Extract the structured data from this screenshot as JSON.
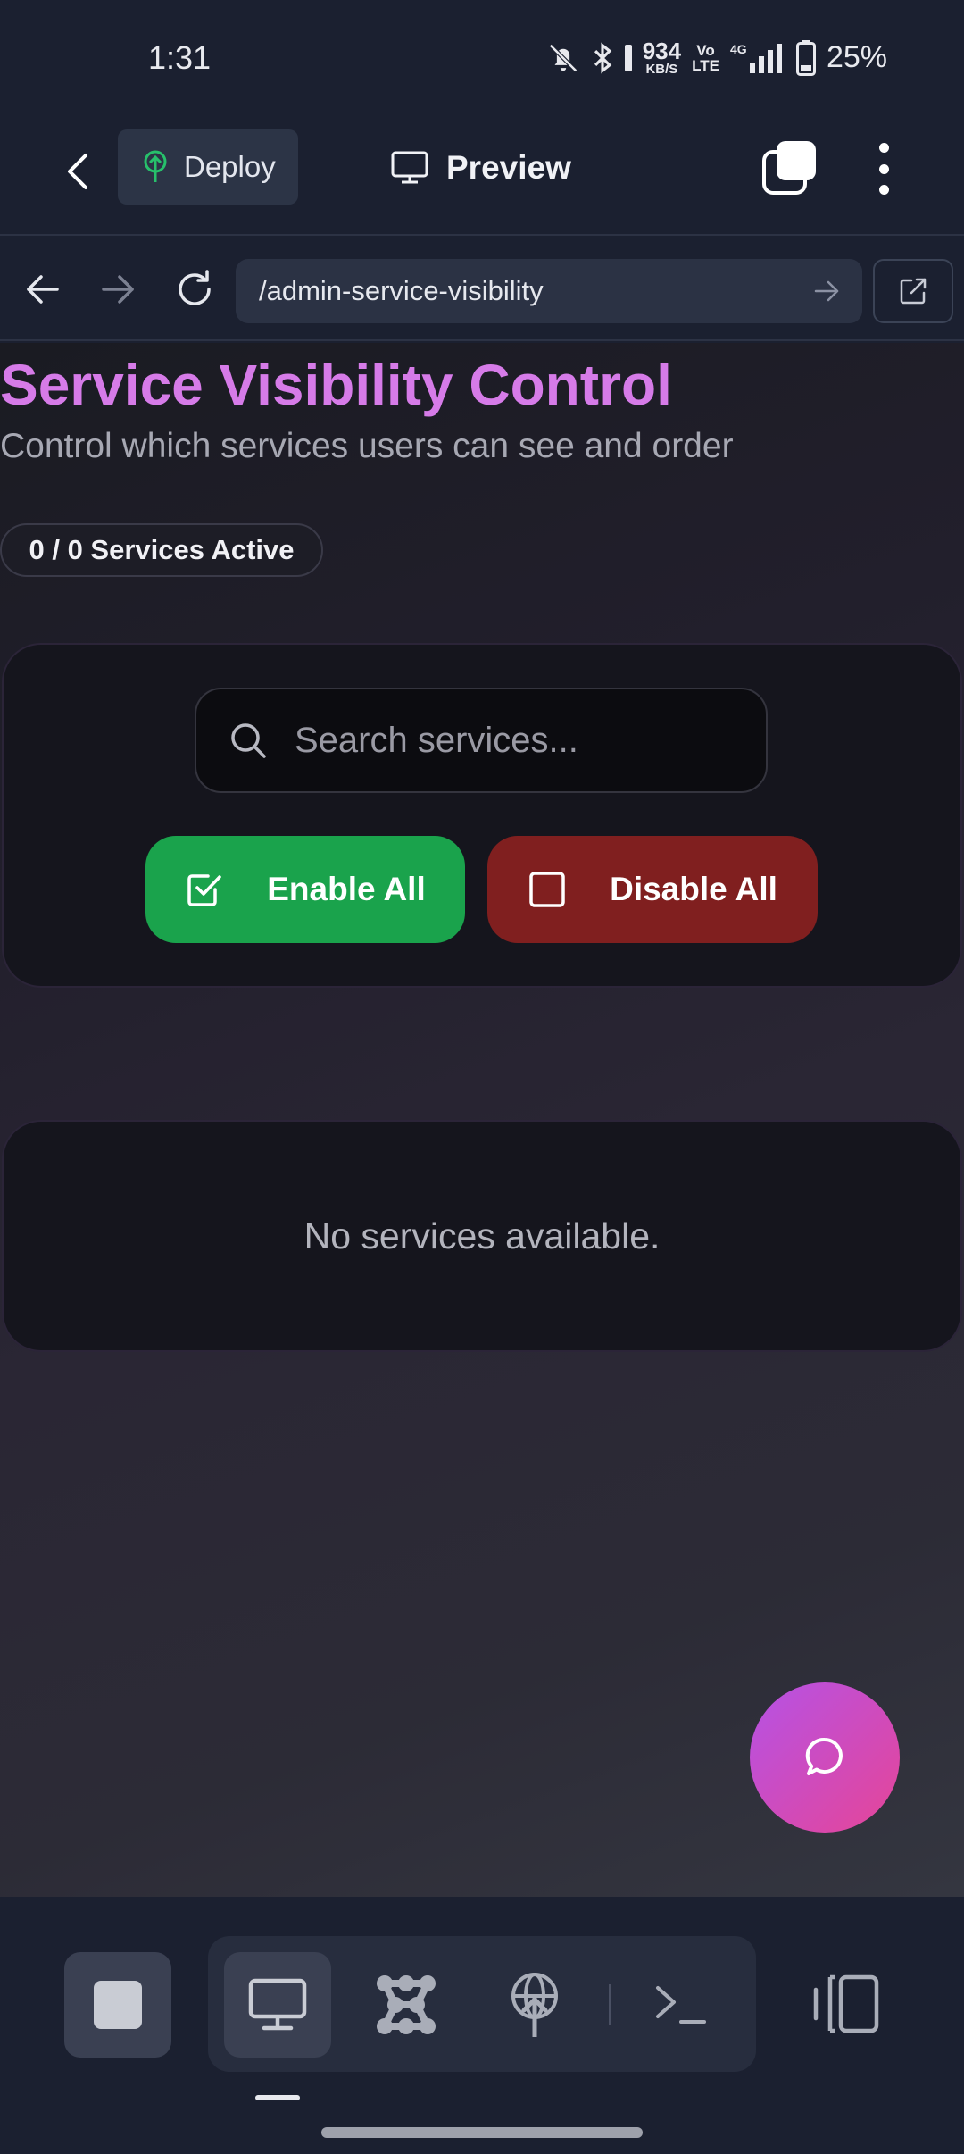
{
  "status_bar": {
    "time": "1:31",
    "net_speed_value": "934",
    "net_speed_unit": "KB/S",
    "volte_top": "Vo",
    "volte_bottom": "LTE",
    "network": "4G",
    "battery": "25%"
  },
  "header": {
    "deploy_label": "Deploy",
    "preview_label": "Preview"
  },
  "browser": {
    "url": "/admin-service-visibility"
  },
  "page": {
    "title": "Service Visibility Control",
    "subtitle": "Control which services users can see and order",
    "active_badge": "0 / 0 Services Active",
    "search_placeholder": "Search services...",
    "enable_all_label": "Enable All",
    "disable_all_label": "Disable All",
    "empty_message": "No services available."
  },
  "colors": {
    "title": "#d67be8",
    "enable_button": "#1aa34c",
    "disable_button": "#801f1f",
    "fab_start": "#b552e6",
    "fab_end": "#e64597"
  },
  "icons": {
    "fab": "chat-bubble-icon",
    "toolbar": [
      "stop-icon",
      "monitor-icon",
      "nodes-icon",
      "globe-upload-icon",
      "terminal-icon",
      "split-layout-icon"
    ]
  }
}
